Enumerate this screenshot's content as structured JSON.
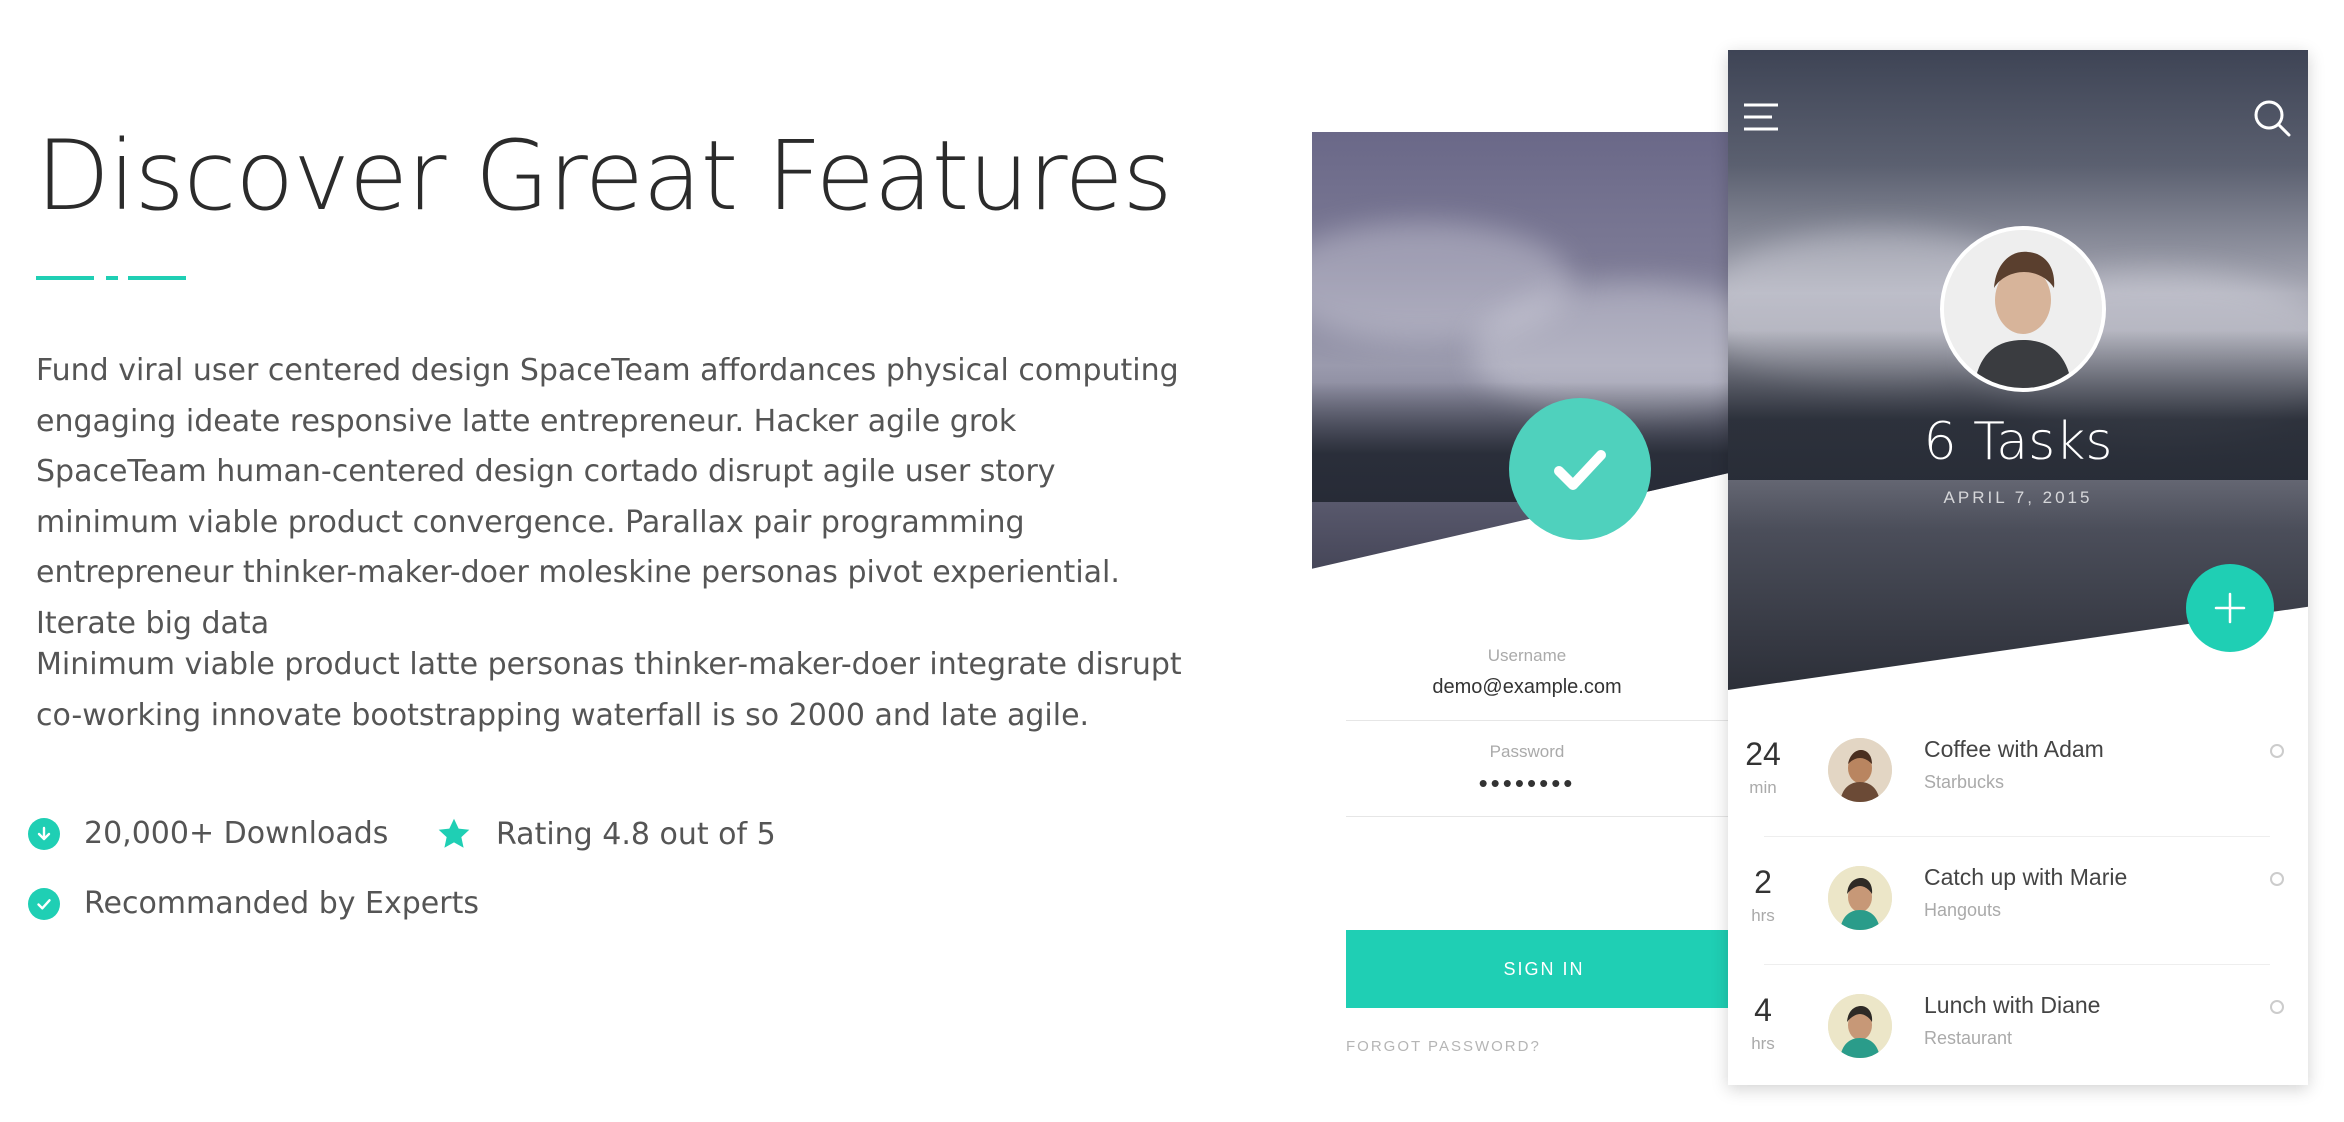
{
  "heading": {
    "title": "Discover Great Features"
  },
  "paragraphs": [
    "Fund viral user centered design SpaceTeam affordances physical computing engaging ideate responsive latte entrepreneur. Hacker agile grok SpaceTeam human-centered design cortado disrupt agile user story minimum viable product convergence. Parallax pair programming entrepreneur thinker-maker-doer moleskine personas pivot experiential. Iterate big data",
    "Minimum viable product latte personas thinker-maker-doer integrate disrupt co-working innovate bootstrapping waterfall is so 2000 and late agile."
  ],
  "features": [
    {
      "icon": "download-icon",
      "label": "20,000+ Downloads"
    },
    {
      "icon": "star-icon",
      "label": "Rating 4.8 out of 5"
    },
    {
      "icon": "check-icon",
      "label": "Recommanded by Experts"
    }
  ],
  "login_screen": {
    "username_label": "Username",
    "username_value": "demo@example.com",
    "password_label": "Password",
    "password_value": "••••••••",
    "sign_in_label": "SIGN IN",
    "forgot_label": "FORGOT PASSWORD?"
  },
  "tasks_screen": {
    "title": "6 Tasks",
    "date": "APRIL 7, 2015",
    "items": [
      {
        "num": "24",
        "unit": "min",
        "title": "Coffee with Adam",
        "subtitle": "Starbucks"
      },
      {
        "num": "2",
        "unit": "hrs",
        "title": "Catch up with Marie",
        "subtitle": "Hangouts"
      },
      {
        "num": "4",
        "unit": "hrs",
        "title": "Lunch with Diane",
        "subtitle": "Restaurant"
      }
    ]
  },
  "colors": {
    "accent": "#1fcfb4",
    "heading": "#2b2b2b",
    "body_text": "#555555"
  }
}
